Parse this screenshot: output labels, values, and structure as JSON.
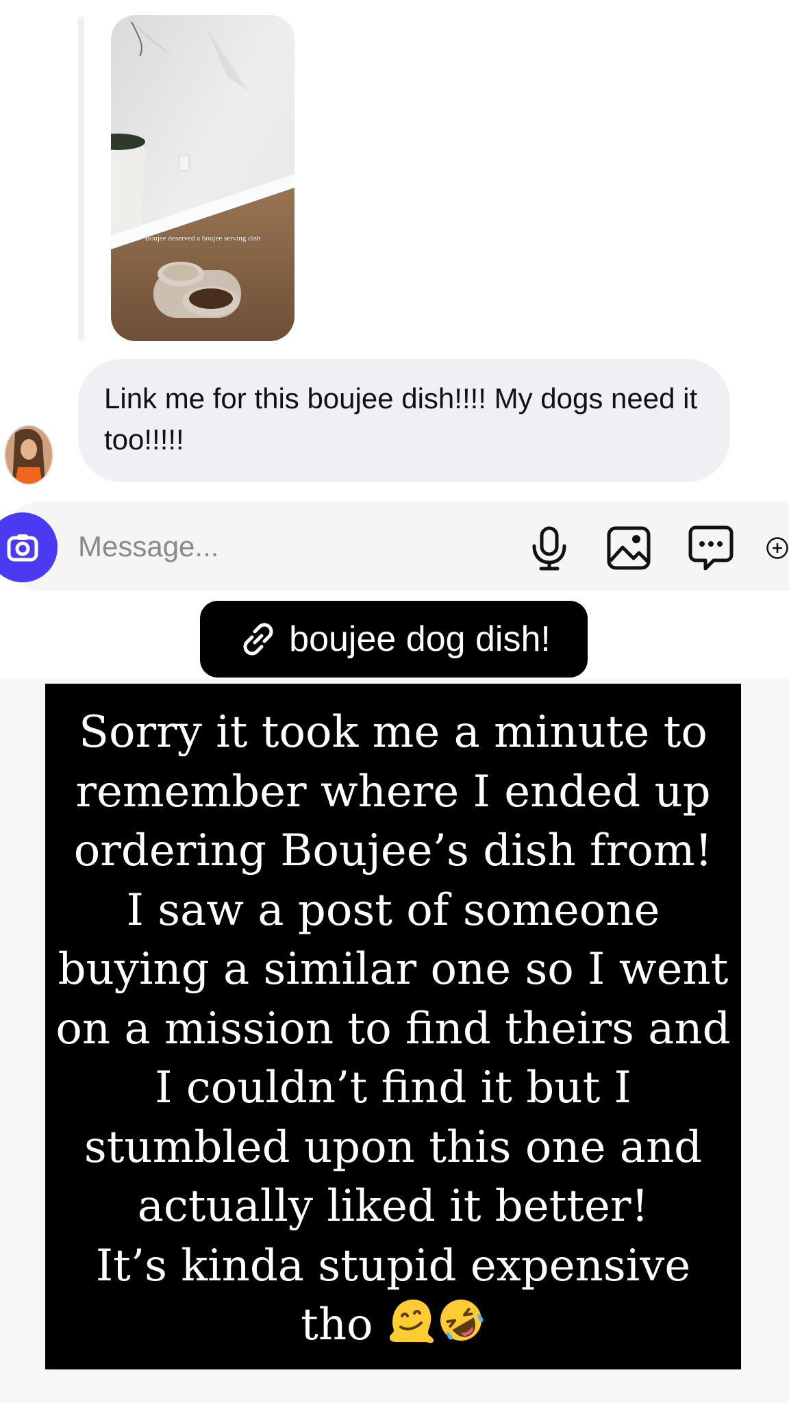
{
  "story_reply": {
    "preview_caption": "Boujee deserved a boujee serving dish"
  },
  "message": {
    "text": "Link me for this boujee dish!!!! My dogs need it too!!!!!"
  },
  "composer": {
    "placeholder": "Message...",
    "icons": [
      "camera-icon",
      "microphone-icon",
      "gallery-icon",
      "chat-bubble-icon",
      "add-icon"
    ],
    "accent_color": "#4a3bf2"
  },
  "story_overlay": {
    "link_sticker_label": "boujee dog dish!",
    "link_icon": "link-icon",
    "caption": "Sorry it took me a minute to\nremember where I ended up\nordering Boujee’s dish from!\nI saw a post of someone\nbuying a similar one so I went\non a mission to find theirs and\nI couldn’t find it but I\nstumbled upon this one and\nactually liked it better!\nIt’s kinda stupid expensive\ntho",
    "caption_emojis": [
      "melting-face-emoji",
      "rolling-on-floor-laughing-emoji"
    ]
  }
}
